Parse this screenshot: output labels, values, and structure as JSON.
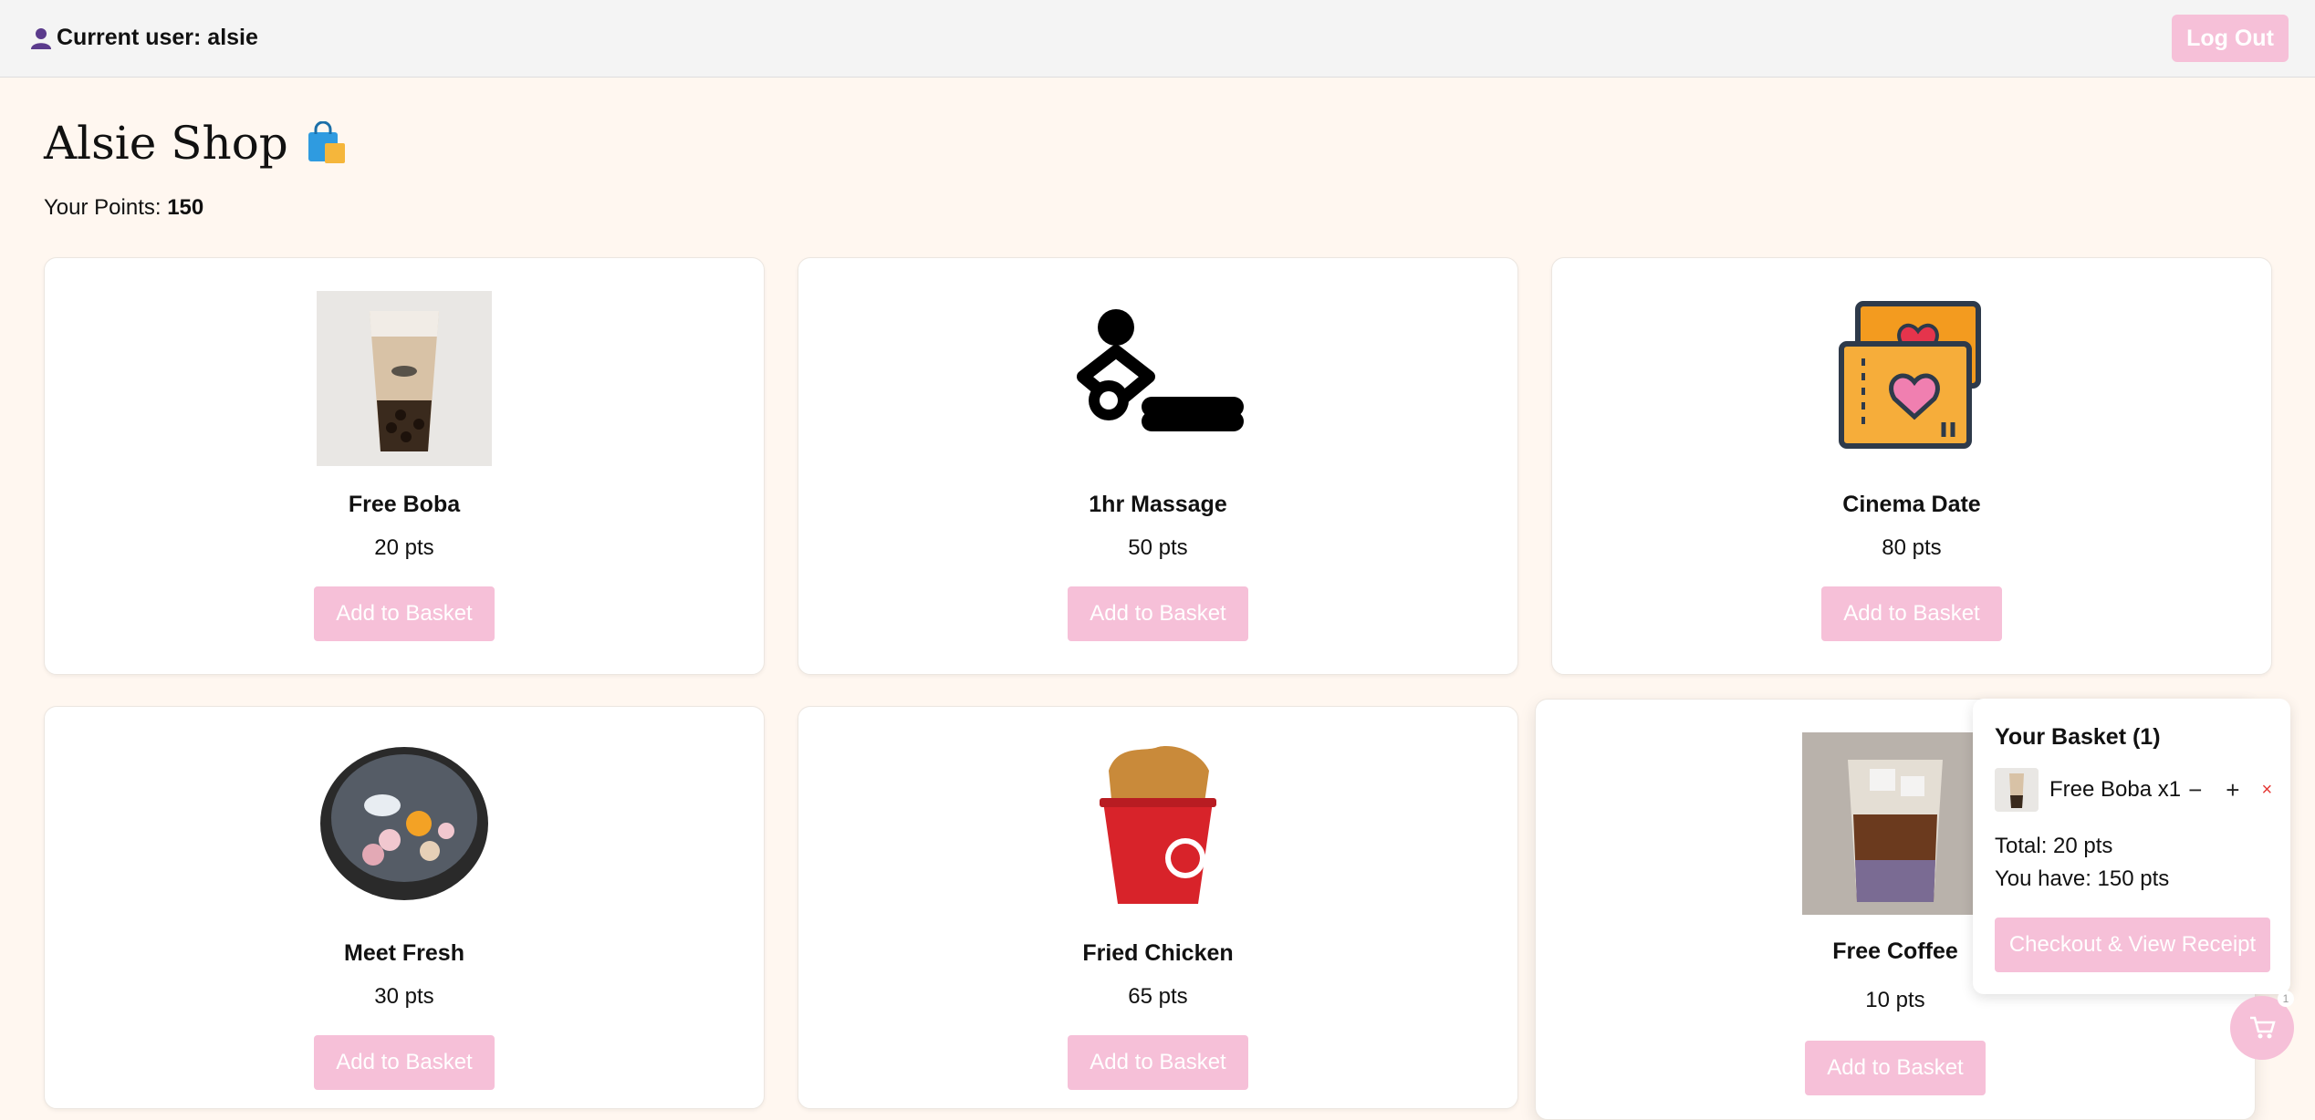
{
  "header": {
    "user_label": "Current user: alsie",
    "logout_label": "Log Out"
  },
  "shop": {
    "title": "Alsie Shop",
    "points_label": "Your Points: ",
    "points_value": "150"
  },
  "products": [
    {
      "name": "Free Boba",
      "price": "20 pts",
      "button": "Add to Basket",
      "icon": "boba-tea-image"
    },
    {
      "name": "1hr Massage",
      "price": "50 pts",
      "button": "Add to Basket",
      "icon": "massage-icon"
    },
    {
      "name": "Cinema Date",
      "price": "80 pts",
      "button": "Add to Basket",
      "icon": "cinema-tickets-icon"
    },
    {
      "name": "Meet Fresh",
      "price": "30 pts",
      "button": "Add to Basket",
      "icon": "dessert-bowl-image"
    },
    {
      "name": "Fried Chicken",
      "price": "65 pts",
      "button": "Add to Basket",
      "icon": "fried-chicken-bucket-image"
    },
    {
      "name": "Free Coffee",
      "price": "10 pts",
      "button": "Add to Basket",
      "icon": "iced-coffee-image"
    }
  ],
  "basket": {
    "title": "Your Basket (1)",
    "items": [
      {
        "label": "Free Boba x1",
        "minus": "−",
        "plus": "+",
        "remove": "×"
      }
    ],
    "total": "Total: 20 pts",
    "have": "You have: 150 pts",
    "checkout_label": "Checkout & View Receipt",
    "badge_count": "1"
  },
  "colors": {
    "accent": "#f6c0d8",
    "background": "#fff7f0",
    "topbar": "#f4f4f4"
  }
}
